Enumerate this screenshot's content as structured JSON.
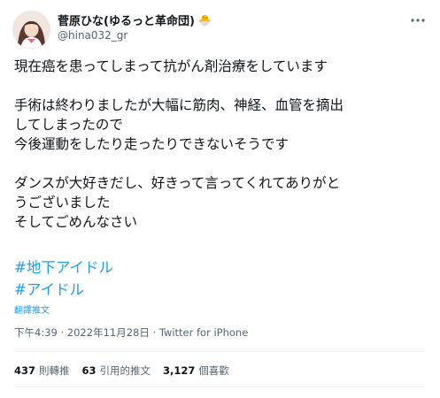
{
  "author": {
    "display_name": "菅原ひな(ゆるっと革命団)",
    "badge_icon": "chick-emoji",
    "badge_glyph": "🐣",
    "handle": "@hina032_gr",
    "avatar_icon": "profile-photo"
  },
  "more_icon": "more-dots-icon",
  "tweet": {
    "lines": [
      "現在癌を患ってしまって抗がん剤治療をしています",
      "",
      "手術は終わりましたが大幅に筋肉、神経、血管を摘出",
      "してしまったので",
      "今後運動をしたり走ったりできないそうです",
      "",
      "ダンスが大好きだし、好きって言ってくれてありがと",
      "うございました",
      "そしてごめんなさい"
    ],
    "hashtags": [
      "#地下アイドル",
      "#アイドル"
    ],
    "translate_label": "翻譯推文"
  },
  "meta": {
    "time": "下午4:39",
    "date": "2022年11月28日",
    "separator": "·",
    "source": "Twitter for iPhone"
  },
  "stats": {
    "retweets_count": "437",
    "retweets_label": "則轉推",
    "quotes_count": "63",
    "quotes_label": "引用的推文",
    "likes_count": "3,127",
    "likes_label": "個喜歡"
  },
  "colors": {
    "text": "#0f1419",
    "secondary": "#536471",
    "link": "#1d9bf0",
    "divider": "#eff3f4"
  }
}
